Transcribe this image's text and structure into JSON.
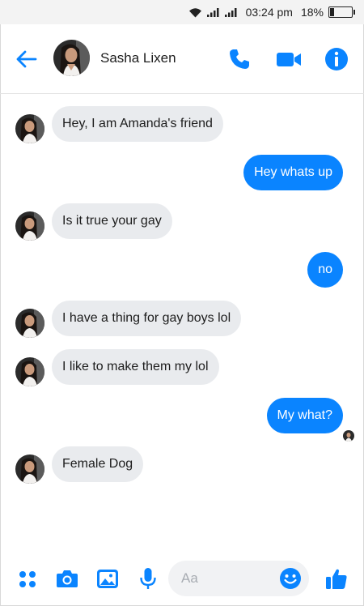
{
  "status_bar": {
    "time": "03:24 pm",
    "battery_text": "18%",
    "battery_level": 0.18,
    "icons": [
      "wifi-icon",
      "signal-icon",
      "signal-icon",
      "battery-icon"
    ]
  },
  "header": {
    "contact_name": "Sasha Lixen",
    "icons": [
      "back-arrow-icon",
      "phone-icon",
      "video-camera-icon",
      "info-icon"
    ]
  },
  "colors": {
    "accent": "#0a84ff",
    "incoming_bubble": "#e9ebee",
    "status_bar_bg": "#f3f3f3"
  },
  "messages": [
    {
      "direction": "in",
      "text": "Hey, I am Amanda's friend"
    },
    {
      "direction": "out",
      "text": "Hey whats up"
    },
    {
      "direction": "in",
      "text": "Is it true your gay"
    },
    {
      "direction": "out",
      "text": "no"
    },
    {
      "direction": "in",
      "text": "I have a thing for gay boys lol"
    },
    {
      "direction": "in",
      "text": "I like to make them my  lol"
    },
    {
      "direction": "out",
      "text": "My what?"
    },
    {
      "direction": "in",
      "text": "Female Dog"
    }
  ],
  "composer": {
    "placeholder": "Aa",
    "icons": [
      "apps-grid-icon",
      "camera-icon",
      "image-icon",
      "microphone-icon",
      "emoji-icon",
      "thumbs-up-icon"
    ]
  }
}
